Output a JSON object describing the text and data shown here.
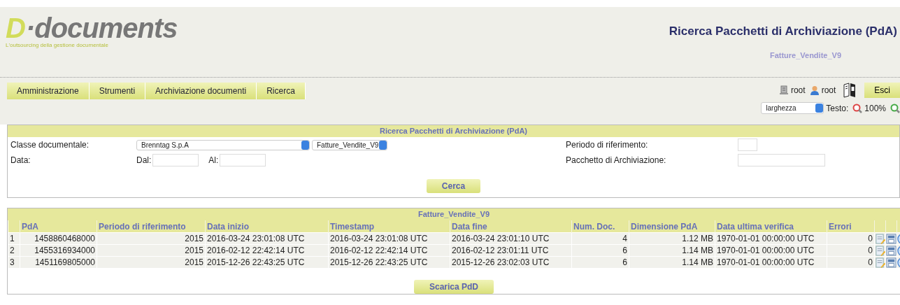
{
  "logo": {
    "mark": "D",
    "name": "·documents",
    "tagline": "L'outsourcing della gestione documentale"
  },
  "header": {
    "title": "Ricerca Pacchetti di Archiviazione (PdA)",
    "subtitle": "Fatture_Vendite_V9"
  },
  "nav": [
    "Amministrazione",
    "Strumenti",
    "Archiviazione documenti",
    "Ricerca"
  ],
  "user_bar": {
    "items": [
      {
        "kind": "computer",
        "label": "root"
      },
      {
        "kind": "user",
        "label": "root"
      }
    ],
    "exit": "Esci",
    "layout_select": "larghezza",
    "text_label": "Testo:",
    "zoom": "100%"
  },
  "search": {
    "title": "Ricerca Pacchetti di Archiviazione (PdA)",
    "class_label": "Classe documentale:",
    "class_value": "Brenntag S.p.A",
    "type_value": "Fatture_Vendite_V9",
    "date_label": "Data:",
    "from_label": "Dal:",
    "to_label": "Al:",
    "period_label": "Periodo di riferimento:",
    "package_label": "Pacchetto di Archiviazione:",
    "button": "Cerca"
  },
  "results": {
    "title": "Fatture_Vendite_V9",
    "columns": [
      "",
      "PdA",
      "Periodo di riferimento",
      "Data inizio",
      "Timestamp",
      "Data fine",
      "Num. Doc.",
      "Dimensione PdA",
      "Data ultima verifica",
      "Errori"
    ],
    "rows": [
      {
        "cells": [
          "1",
          "1458860468000",
          "2015",
          "2016-03-24 23:01:08 UTC",
          "2016-03-24 23:01:08 UTC",
          "2016-03-24 23:01:10 UTC",
          "4",
          "1.12 MB",
          "1970-01-01 00:00:00 UTC",
          "0"
        ]
      },
      {
        "cells": [
          "2",
          "1455316934000",
          "2015",
          "2016-02-12 22:42:14 UTC",
          "2016-02-12 22:42:14 UTC",
          "2016-02-12 23:01:11 UTC",
          "6",
          "1.14 MB",
          "1970-01-01 00:00:00 UTC",
          "0"
        ]
      },
      {
        "cells": [
          "3",
          "1451169805000",
          "2015",
          "2015-12-26 22:43:25 UTC",
          "2015-12-26 22:43:25 UTC",
          "2015-12-26 23:02:03 UTC",
          "6",
          "1.14 MB",
          "1970-01-01 00:00:00 UTC",
          "0"
        ]
      }
    ],
    "button": "Scarica PdD"
  }
}
